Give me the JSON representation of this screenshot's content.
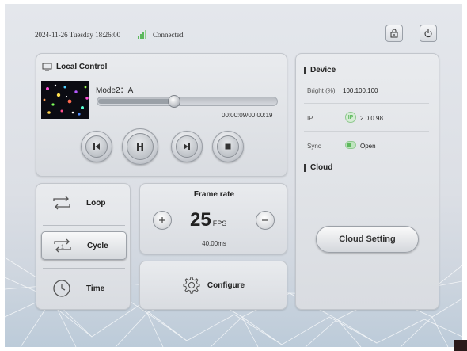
{
  "status": {
    "datetime": "2024-11-26 Tuesday 18:26:00",
    "connection": "Connected"
  },
  "local_control": {
    "title": "Local Control",
    "mode": "Mode2：A",
    "time": "00:00:09/00:00:19",
    "progress": 0.43
  },
  "play_modes": [
    {
      "label": "Loop"
    },
    {
      "label": "Cycle"
    },
    {
      "label": "Time"
    }
  ],
  "frame_rate": {
    "title": "Frame rate",
    "value": "25",
    "unit": "FPS",
    "interval": "40.00ms"
  },
  "configure": {
    "label": "Configure"
  },
  "device": {
    "title": "Device",
    "bright_label": "Bright (%)",
    "bright_value": "100,100,100",
    "ip_label": "IP",
    "ip_value": "2.0.0.98",
    "sync_label": "Sync",
    "sync_value": "Open"
  },
  "cloud": {
    "title": "Cloud",
    "button": "Cloud Setting"
  },
  "colors": {
    "accent": "#5cb85c"
  }
}
